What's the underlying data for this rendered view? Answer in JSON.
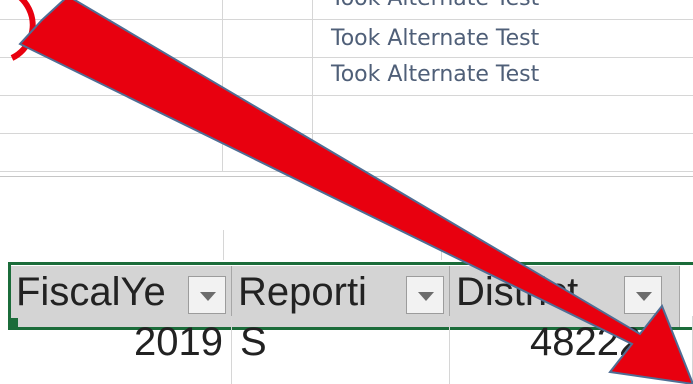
{
  "top_table": {
    "rows": [
      "Took Alternate Test",
      "Took Alternate Test",
      "Took Alternate Test",
      "",
      ""
    ]
  },
  "bottom_table": {
    "headers": [
      "FiscalYe",
      "Reporti",
      "District"
    ],
    "row": {
      "fiscal_year": "2019",
      "reporting": "S",
      "district": "48222"
    }
  },
  "overlay": {
    "arrow_color": "#e8000f",
    "circle_color": "#e8000f"
  }
}
